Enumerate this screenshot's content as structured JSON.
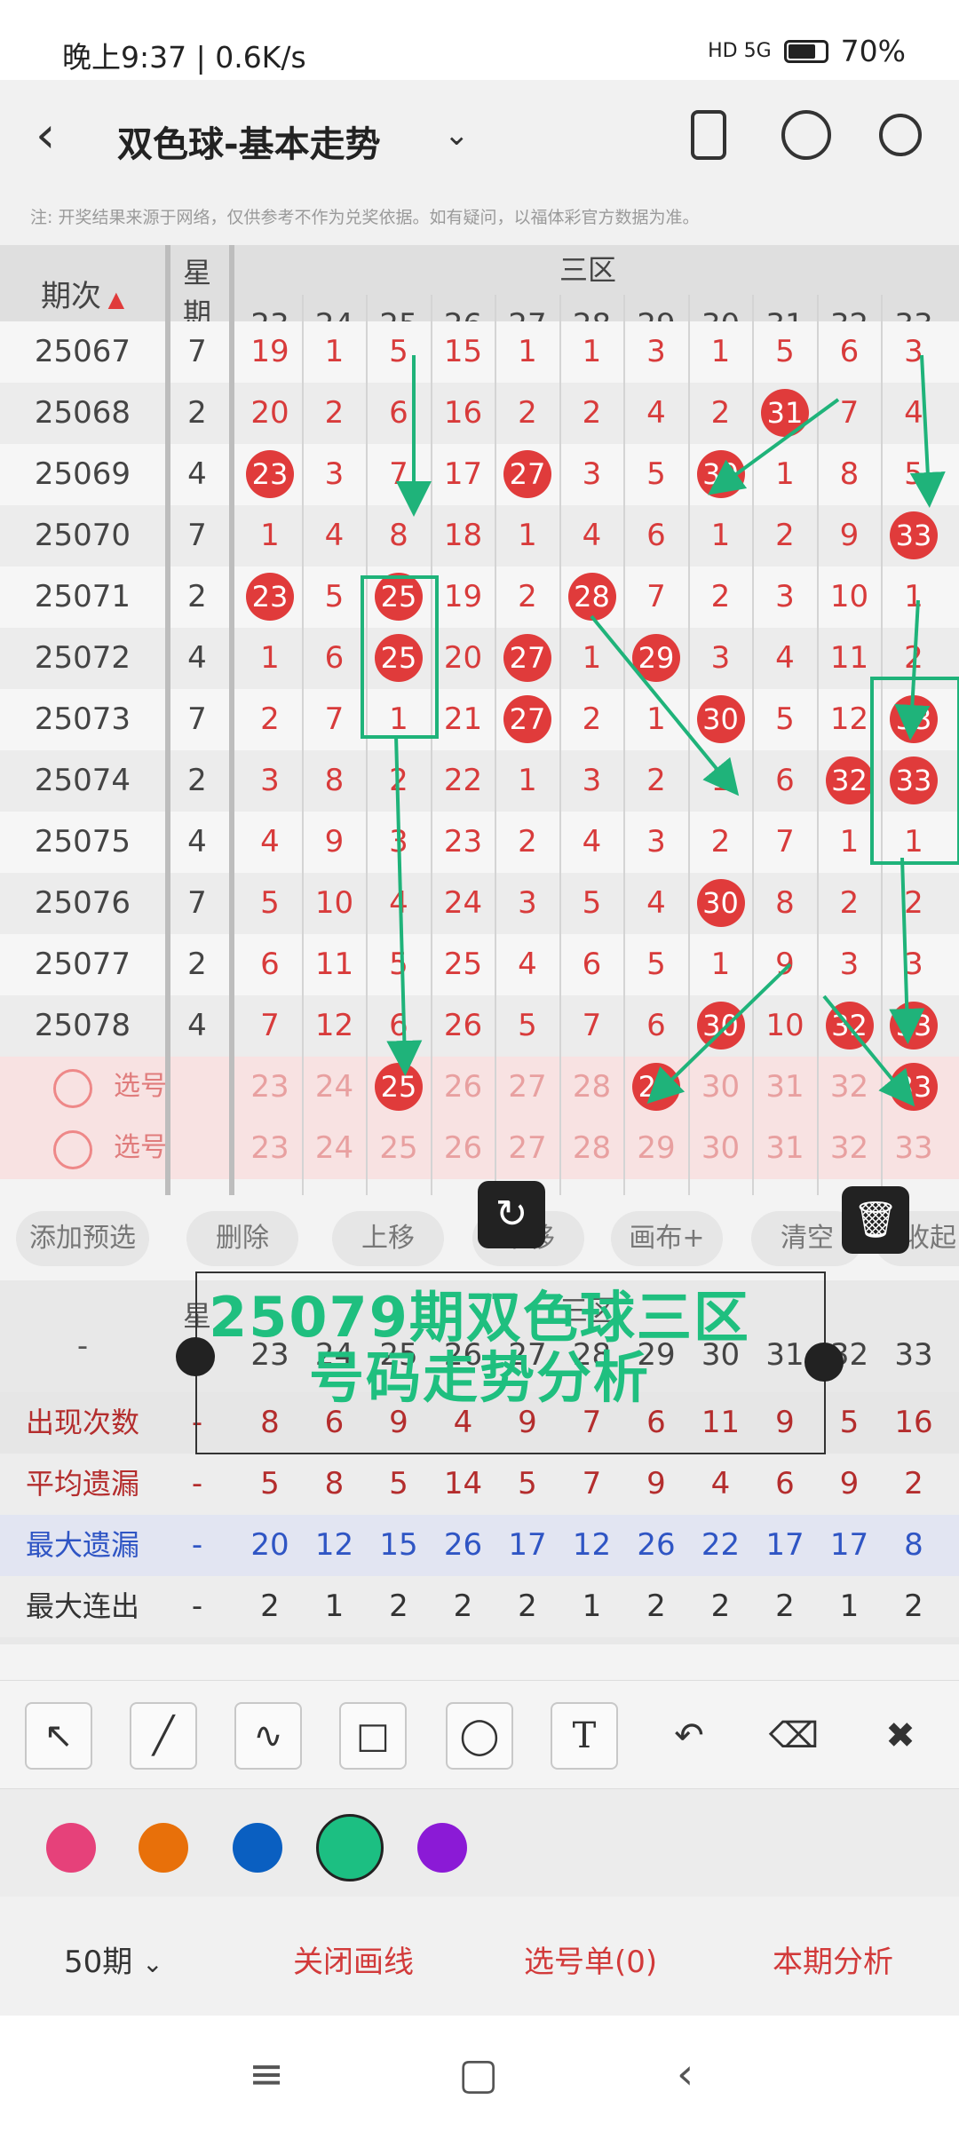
{
  "status_bar": {
    "time": "晚上9:37 | 0.6K/s",
    "network": "HD 5G",
    "battery": "70%"
  },
  "header": {
    "title": "双色球-基本走势",
    "note": "注: 开奖结果来源于网络，仅供参考不作为兑奖依据。如有疑问，以福体彩官方数据为准。"
  },
  "table": {
    "col_period": "期次",
    "col_week": "星期",
    "section": "三区",
    "numbers": [
      "23",
      "24",
      "25",
      "26",
      "27",
      "28",
      "29",
      "30",
      "31",
      "32",
      "33"
    ],
    "rows": [
      {
        "period": "25067",
        "week": "7",
        "cells": [
          "19",
          "1",
          "5",
          "15",
          "1",
          "1",
          "3",
          "1",
          "5",
          "6",
          "3"
        ],
        "hits": []
      },
      {
        "period": "25068",
        "week": "2",
        "cells": [
          "20",
          "2",
          "6",
          "16",
          "2",
          "2",
          "4",
          "2",
          "31",
          "7",
          "4"
        ],
        "hits": [
          8
        ]
      },
      {
        "period": "25069",
        "week": "4",
        "cells": [
          "23",
          "3",
          "7",
          "17",
          "27",
          "3",
          "5",
          "30",
          "1",
          "8",
          "5"
        ],
        "hits": [
          0,
          4,
          7
        ]
      },
      {
        "period": "25070",
        "week": "7",
        "cells": [
          "1",
          "4",
          "8",
          "18",
          "1",
          "4",
          "6",
          "1",
          "2",
          "9",
          "33"
        ],
        "hits": [
          10
        ]
      },
      {
        "period": "25071",
        "week": "2",
        "cells": [
          "23",
          "5",
          "25",
          "19",
          "2",
          "28",
          "7",
          "2",
          "3",
          "10",
          "1"
        ],
        "hits": [
          0,
          2,
          5
        ]
      },
      {
        "period": "25072",
        "week": "4",
        "cells": [
          "1",
          "6",
          "25",
          "20",
          "27",
          "1",
          "29",
          "3",
          "4",
          "11",
          "2"
        ],
        "hits": [
          2,
          4,
          6
        ]
      },
      {
        "period": "25073",
        "week": "7",
        "cells": [
          "2",
          "7",
          "1",
          "21",
          "27",
          "2",
          "1",
          "30",
          "5",
          "12",
          "33"
        ],
        "hits": [
          4,
          7,
          10
        ]
      },
      {
        "period": "25074",
        "week": "2",
        "cells": [
          "3",
          "8",
          "2",
          "22",
          "1",
          "3",
          "2",
          "1",
          "6",
          "32",
          "33"
        ],
        "hits": [
          9,
          10
        ]
      },
      {
        "period": "25075",
        "week": "4",
        "cells": [
          "4",
          "9",
          "3",
          "23",
          "2",
          "4",
          "3",
          "2",
          "7",
          "1",
          "1"
        ],
        "hits": []
      },
      {
        "period": "25076",
        "week": "7",
        "cells": [
          "5",
          "10",
          "4",
          "24",
          "3",
          "5",
          "4",
          "30",
          "8",
          "2",
          "2"
        ],
        "hits": [
          7
        ]
      },
      {
        "period": "25077",
        "week": "2",
        "cells": [
          "6",
          "11",
          "5",
          "25",
          "4",
          "6",
          "5",
          "1",
          "9",
          "3",
          "3"
        ],
        "hits": []
      },
      {
        "period": "25078",
        "week": "4",
        "cells": [
          "7",
          "12",
          "6",
          "26",
          "5",
          "7",
          "6",
          "30",
          "10",
          "32",
          "33"
        ],
        "hits": [
          7,
          9,
          10
        ]
      }
    ],
    "pick_rows": [
      {
        "label": "选号",
        "cells": [
          "23",
          "24",
          "25",
          "26",
          "27",
          "28",
          "29",
          "30",
          "31",
          "32",
          "33"
        ],
        "hits": [
          2,
          6,
          10
        ]
      },
      {
        "label": "选号",
        "cells": [
          "23",
          "24",
          "25",
          "26",
          "27",
          "28",
          "29",
          "30",
          "31",
          "32",
          "33"
        ],
        "hits": []
      }
    ]
  },
  "action_bar": [
    "添加预选",
    "删除",
    "上移",
    "下移",
    "画布+",
    "清空",
    "收起"
  ],
  "stats": {
    "dash": "-",
    "section": "三区",
    "week_short": "星",
    "rows": [
      {
        "label": "出现次数",
        "color": "#b42d2d",
        "dash": "-",
        "values": [
          "8",
          "6",
          "9",
          "4",
          "9",
          "7",
          "6",
          "11",
          "9",
          "5",
          "16"
        ]
      },
      {
        "label": "平均遗漏",
        "color": "#b42d2d",
        "dash": "-",
        "values": [
          "5",
          "8",
          "5",
          "14",
          "5",
          "7",
          "9",
          "4",
          "6",
          "9",
          "2"
        ]
      },
      {
        "label": "最大遗漏",
        "color": "#2f55c4",
        "dash": "-",
        "values": [
          "20",
          "12",
          "15",
          "26",
          "17",
          "12",
          "26",
          "22",
          "17",
          "17",
          "8"
        ]
      },
      {
        "label": "最大连出",
        "color": "#333333",
        "dash": "-",
        "values": [
          "2",
          "1",
          "2",
          "2",
          "2",
          "1",
          "2",
          "2",
          "2",
          "1",
          "2"
        ]
      }
    ]
  },
  "overlay_text": [
    "25079期双色球三区",
    "号码走势分析"
  ],
  "tools": [
    "arrow-tool",
    "line-tool",
    "freehand-tool",
    "rect-tool",
    "circle-tool",
    "text-tool",
    "undo-tool",
    "eraser-tool",
    "clear-tool"
  ],
  "colors": [
    "#e6417a",
    "#e8700a",
    "#0a5fc1",
    "#1cbf82",
    "#8b1ad6"
  ],
  "bottom": {
    "period_select": "50期",
    "close_line": "关闭画线",
    "pick_list": "选号单(0)",
    "analysis": "本期分析"
  }
}
